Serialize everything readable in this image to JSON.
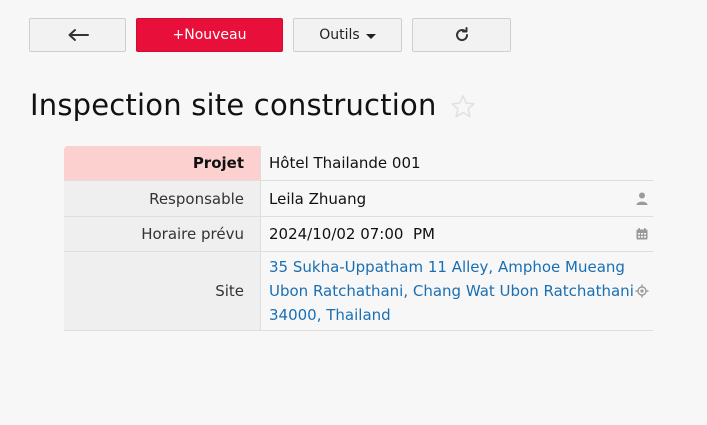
{
  "toolbar": {
    "back_icon": "arrow-left-icon",
    "new_label": "+Nouveau",
    "tools_label": "Outils",
    "refresh_icon": "refresh-icon",
    "new_color": "#e8103a"
  },
  "page": {
    "title": "Inspection site construction",
    "favorite_icon": "star-icon"
  },
  "fields": {
    "project": {
      "label": "Projet",
      "value": "Hôtel Thailande 001",
      "highlight_color": "#fdd0d0"
    },
    "owner": {
      "label": "Responsable",
      "value": "Leila Zhuang",
      "icon": "user-icon"
    },
    "schedule": {
      "label": "Horaire prévu",
      "value": "2024/10/02 07:00  PM",
      "icon": "calendar-icon"
    },
    "site": {
      "label": "Site",
      "value": "35 Sukha-Uppatham 11 Alley, Amphoe Mueang\nUbon Ratchathani, Chang Wat Ubon Ratchathani\n34000, Thailand",
      "icon": "location-icon",
      "link_color": "#1a6fb3"
    }
  }
}
